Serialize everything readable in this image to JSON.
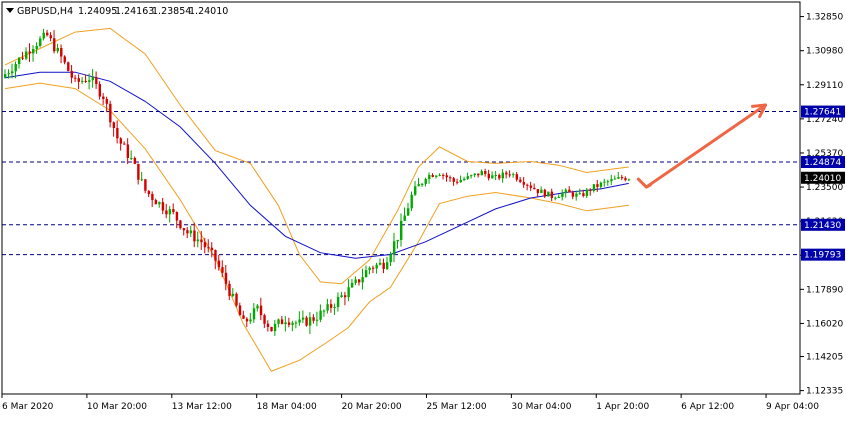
{
  "header": {
    "symbol": "GBPUSD,H4",
    "open": "1.24095",
    "high": "1.24163",
    "low": "1.23854",
    "close": "1.24010"
  },
  "colors": {
    "candle_up": "#00aa00",
    "candle_down": "#d40000",
    "bollinger": "#f0a020",
    "moving_average": "#1010c8",
    "level_line": "#000080",
    "level_label_bg": "#0000aa",
    "price_label_bg": "#000000",
    "arrow": "#ee6644"
  },
  "chart_data": {
    "type": "candlestick",
    "symbol": "GBPUSD",
    "timeframe": "H4",
    "ylim": [
      1.1215,
      1.3365
    ],
    "y_ticks": [
      "1.32850",
      "1.30980",
      "1.29110",
      "1.27240",
      "1.25370",
      "1.23500",
      "1.21630",
      "1.19760",
      "1.17890",
      "1.16020",
      "1.14205",
      "1.12335"
    ],
    "x_ticks": [
      "6 Mar 2020",
      "10 Mar 20:00",
      "13 Mar 12:00",
      "18 Mar 04:00",
      "20 Mar 20:00",
      "25 Mar 12:00",
      "30 Mar 04:00",
      "1 Apr 20:00",
      "6 Apr 12:00",
      "9 Apr 04:00"
    ],
    "levels": [
      {
        "value": 1.27641,
        "label": "1.27641"
      },
      {
        "value": 1.24874,
        "label": "1.24874"
      },
      {
        "value": 1.2143,
        "label": "1.21430"
      },
      {
        "value": 1.19793,
        "label": "1.19793"
      }
    ],
    "current_price": {
      "value": 1.2401,
      "label": "1.24010"
    },
    "close_path": [
      [
        0,
        1.297
      ],
      [
        4,
        1.305
      ],
      [
        8,
        1.313
      ],
      [
        12,
        1.318
      ],
      [
        16,
        1.306
      ],
      [
        20,
        1.292
      ],
      [
        24,
        1.295
      ],
      [
        28,
        1.285
      ],
      [
        32,
        1.262
      ],
      [
        36,
        1.25
      ],
      [
        40,
        1.233
      ],
      [
        44,
        1.226
      ],
      [
        48,
        1.22
      ],
      [
        52,
        1.21
      ],
      [
        56,
        1.205
      ],
      [
        60,
        1.195
      ],
      [
        64,
        1.178
      ],
      [
        68,
        1.16
      ],
      [
        72,
        1.168
      ],
      [
        76,
        1.157
      ],
      [
        80,
        1.163
      ],
      [
        84,
        1.16
      ],
      [
        88,
        1.163
      ],
      [
        92,
        1.168
      ],
      [
        96,
        1.175
      ],
      [
        100,
        1.182
      ],
      [
        104,
        1.191
      ],
      [
        108,
        1.193
      ],
      [
        112,
        1.208
      ],
      [
        116,
        1.23
      ],
      [
        120,
        1.241
      ],
      [
        124,
        1.243
      ],
      [
        128,
        1.238
      ],
      [
        132,
        1.24
      ],
      [
        136,
        1.243
      ],
      [
        140,
        1.24
      ],
      [
        144,
        1.243
      ],
      [
        148,
        1.238
      ],
      [
        152,
        1.233
      ],
      [
        156,
        1.23
      ],
      [
        160,
        1.232
      ],
      [
        164,
        1.23
      ],
      [
        168,
        1.235
      ],
      [
        172,
        1.238
      ],
      [
        176,
        1.24
      ],
      [
        178,
        1.2401
      ]
    ],
    "moving_average": [
      [
        0,
        1.295
      ],
      [
        10,
        1.298
      ],
      [
        20,
        1.298
      ],
      [
        30,
        1.293
      ],
      [
        40,
        1.282
      ],
      [
        50,
        1.268
      ],
      [
        60,
        1.248
      ],
      [
        70,
        1.225
      ],
      [
        80,
        1.208
      ],
      [
        90,
        1.199
      ],
      [
        100,
        1.196
      ],
      [
        110,
        1.198
      ],
      [
        120,
        1.205
      ],
      [
        130,
        1.214
      ],
      [
        140,
        1.223
      ],
      [
        150,
        1.229
      ],
      [
        160,
        1.232
      ],
      [
        170,
        1.234
      ],
      [
        178,
        1.237
      ]
    ],
    "bollinger_upper": [
      [
        0,
        1.302
      ],
      [
        10,
        1.311
      ],
      [
        20,
        1.32
      ],
      [
        30,
        1.322
      ],
      [
        40,
        1.308
      ],
      [
        50,
        1.28
      ],
      [
        60,
        1.255
      ],
      [
        70,
        1.248
      ],
      [
        78,
        1.225
      ],
      [
        84,
        1.198
      ],
      [
        90,
        1.183
      ],
      [
        96,
        1.182
      ],
      [
        104,
        1.195
      ],
      [
        112,
        1.222
      ],
      [
        118,
        1.246
      ],
      [
        124,
        1.257
      ],
      [
        132,
        1.249
      ],
      [
        140,
        1.248
      ],
      [
        150,
        1.249
      ],
      [
        158,
        1.247
      ],
      [
        166,
        1.243
      ],
      [
        174,
        1.245
      ],
      [
        178,
        1.246
      ]
    ],
    "bollinger_lower": [
      [
        0,
        1.289
      ],
      [
        10,
        1.292
      ],
      [
        20,
        1.289
      ],
      [
        30,
        1.277
      ],
      [
        40,
        1.256
      ],
      [
        50,
        1.228
      ],
      [
        60,
        1.196
      ],
      [
        68,
        1.16
      ],
      [
        76,
        1.134
      ],
      [
        84,
        1.14
      ],
      [
        92,
        1.15
      ],
      [
        98,
        1.158
      ],
      [
        104,
        1.172
      ],
      [
        110,
        1.18
      ],
      [
        118,
        1.205
      ],
      [
        124,
        1.226
      ],
      [
        132,
        1.23
      ],
      [
        140,
        1.232
      ],
      [
        150,
        1.229
      ],
      [
        158,
        1.226
      ],
      [
        166,
        1.222
      ],
      [
        174,
        1.224
      ],
      [
        178,
        1.225
      ]
    ],
    "arrow": {
      "from": [
        183,
        1.235
      ],
      "to": [
        217,
        1.28
      ]
    }
  }
}
